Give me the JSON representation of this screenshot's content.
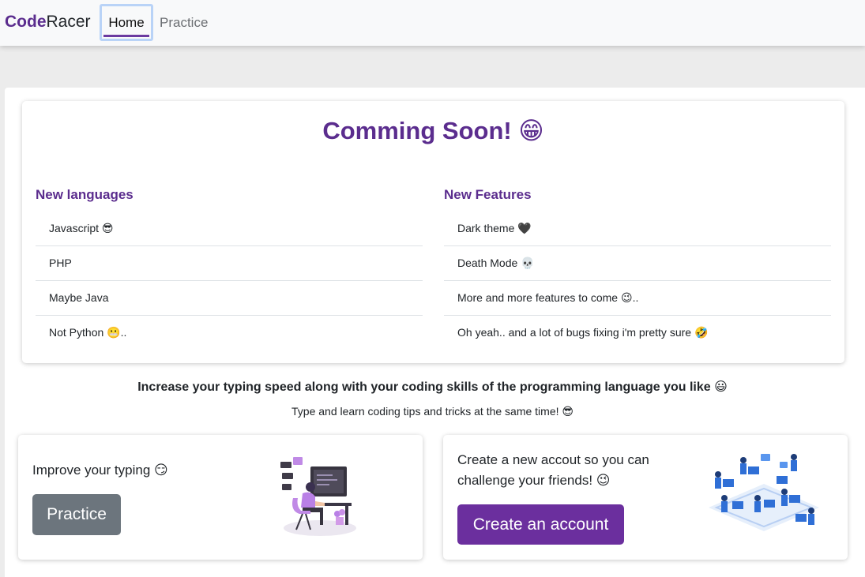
{
  "nav": {
    "brand_bold": "Code",
    "brand_rest": "Racer",
    "links": [
      {
        "label": "Home",
        "active": true
      },
      {
        "label": "Practice",
        "active": false
      }
    ]
  },
  "coming_soon": {
    "title": "Comming Soon! 😁",
    "languages": {
      "heading": "New languages",
      "items": [
        "Javascript 😎",
        "PHP",
        "Maybe Java",
        "Not Python 😬.."
      ]
    },
    "features": {
      "heading": "New Features",
      "items": [
        "Dark theme 🖤",
        "Death Mode 💀",
        "More and more features to come 😉..",
        "Oh yeah.. and a lot of bugs fixing i'm pretty sure 🤣"
      ]
    }
  },
  "tagline": "Increase your typing speed along with your coding skills of the programming language you like 😃",
  "subtagline": "Type and learn coding tips and tricks at the same time! 😎",
  "cards": {
    "practice": {
      "text": "Improve your typing 😏",
      "button": "Practice"
    },
    "account": {
      "text_line1": "Create a new accout so you can",
      "text_line2": "challenge your friends! 😉",
      "button": "Create an account"
    }
  },
  "colors": {
    "brand": "#5b2d8e",
    "practice_button": "#6c757d",
    "account_button": "#6b2f9e"
  },
  "icons": [
    "typing-person-illustration",
    "team-network-illustration"
  ]
}
